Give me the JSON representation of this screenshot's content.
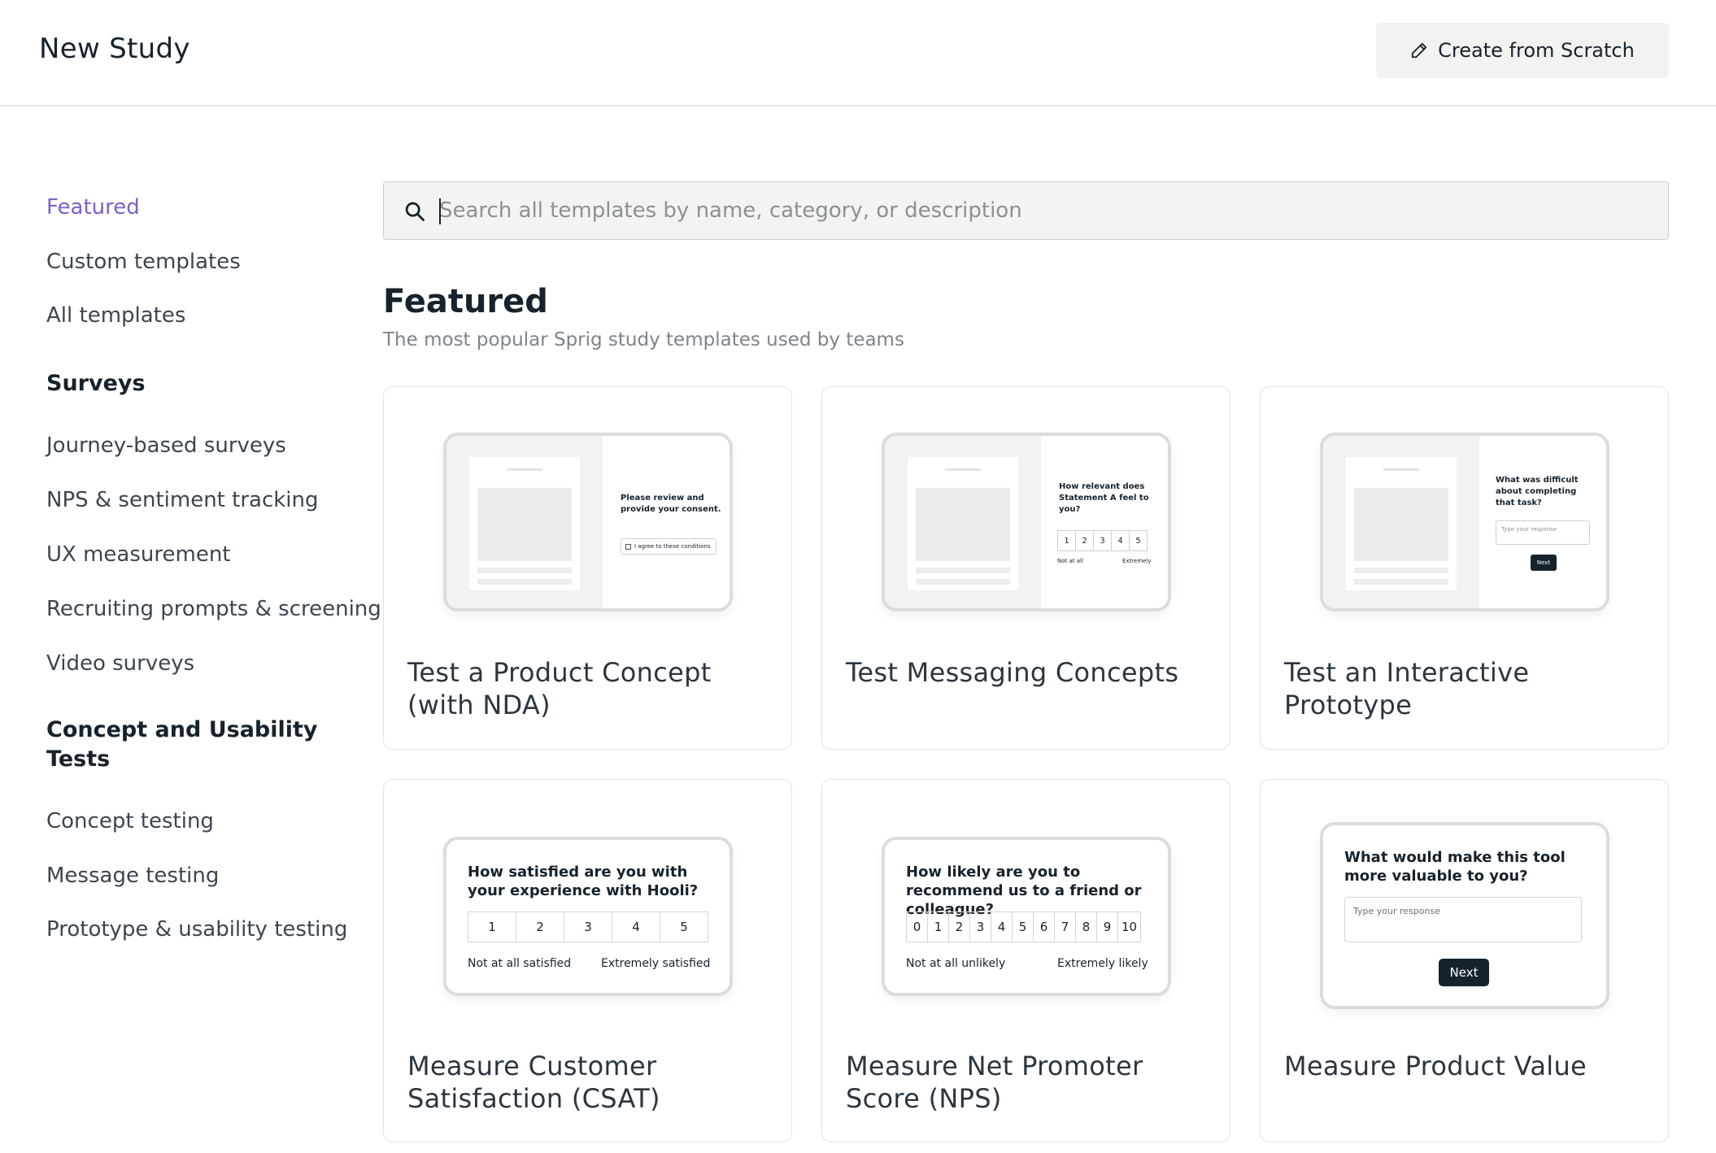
{
  "header": {
    "title": "New Study",
    "create_button": "Create from Scratch",
    "create_icon": "pencil-icon"
  },
  "sidebar": {
    "top_items": [
      {
        "label": "Featured",
        "active": true
      },
      {
        "label": "Custom templates",
        "active": false
      },
      {
        "label": "All templates",
        "active": false
      }
    ],
    "groups": [
      {
        "heading": "Surveys",
        "items": [
          "Journey-based surveys",
          "NPS & sentiment tracking",
          "UX measurement",
          "Recruiting prompts & screening",
          "Video surveys"
        ]
      },
      {
        "heading": "Concept and Usability Tests",
        "items": [
          "Concept testing",
          "Message testing",
          "Prototype & usability testing"
        ]
      }
    ]
  },
  "search": {
    "placeholder": "Search all templates by name, category, or description",
    "value": "",
    "icon": "search-icon"
  },
  "section": {
    "title": "Featured",
    "subtitle": "The most popular Sprig study templates used by teams"
  },
  "cards": [
    {
      "title": "Test a Product Concept (with NDA)",
      "preview": {
        "question": "Please review and provide your consent.",
        "checkbox_label": "I agree to these conditions"
      }
    },
    {
      "title": "Test Messaging Concepts",
      "preview": {
        "question": "How relevant does Statement A feel to you?",
        "scale": [
          "1",
          "2",
          "3",
          "4",
          "5"
        ],
        "low_label": "Not at all",
        "high_label": "Extremely"
      }
    },
    {
      "title": "Test an Interactive Prototype",
      "preview": {
        "question": "What was difficult about completing that task?",
        "input_placeholder": "Type your response",
        "button": "Next"
      }
    },
    {
      "title": "Measure Customer Satisfaction (CSAT)",
      "preview": {
        "question": "How satisfied are you with your experience with Hooli?",
        "scale": [
          "1",
          "2",
          "3",
          "4",
          "5"
        ],
        "low_label": "Not at all satisfied",
        "high_label": "Extremely satisfied"
      }
    },
    {
      "title": "Measure Net Promoter Score (NPS)",
      "preview": {
        "question": "How likely are you to recommend us to a friend or colleague?",
        "scale": [
          "0",
          "1",
          "2",
          "3",
          "4",
          "5",
          "6",
          "7",
          "8",
          "9",
          "10"
        ],
        "low_label": "Not at all unlikely",
        "high_label": "Extremely likely"
      }
    },
    {
      "title": "Measure Product Value",
      "preview": {
        "question": "What would make this tool more valuable to you?",
        "input_placeholder": "Type your response",
        "button": "Next"
      }
    }
  ],
  "colors": {
    "accent": "#7a62c7",
    "text": "#16232e",
    "button_bg": "#f2f2f0",
    "dark_button": "#16232e"
  }
}
